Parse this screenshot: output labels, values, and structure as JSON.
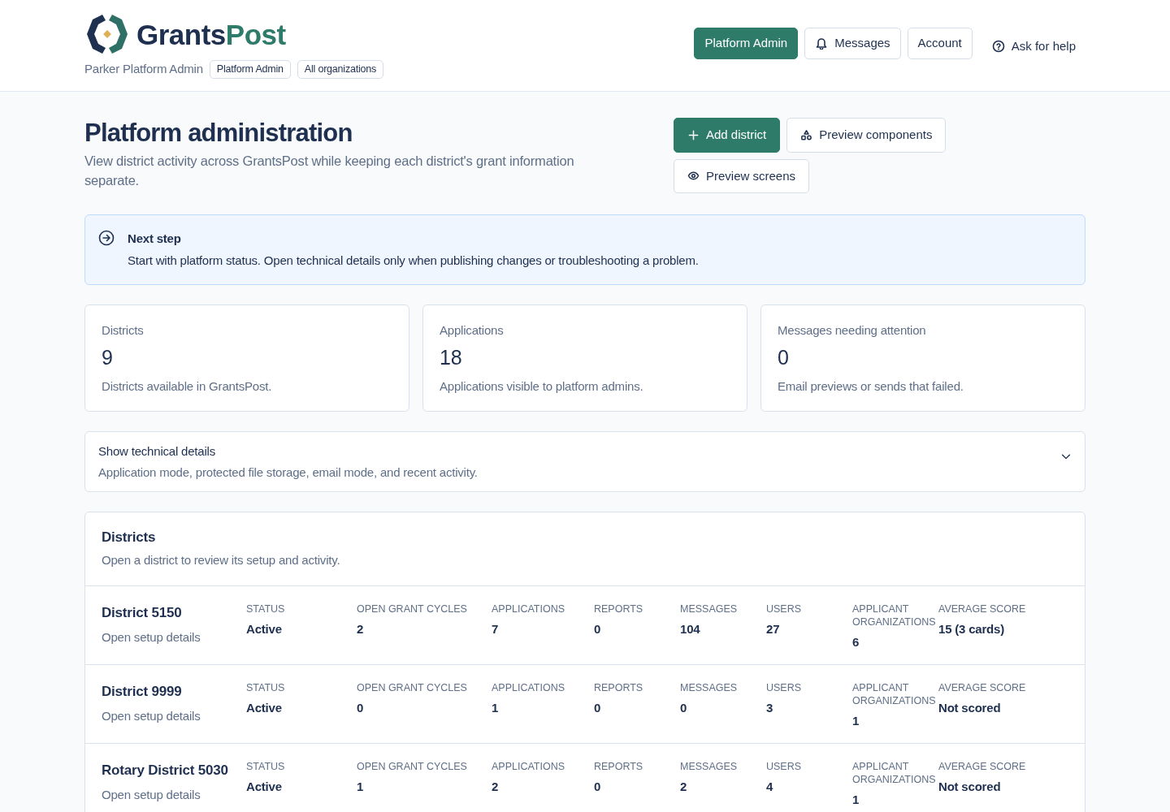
{
  "header": {
    "brand": {
      "first": "Grants",
      "second": "Post"
    },
    "user": "Parker Platform Admin",
    "badges": [
      "Platform Admin",
      "All organizations"
    ],
    "nav": [
      {
        "label": "Platform Admin",
        "kind": "primary",
        "selected": true
      },
      {
        "label": "Messages",
        "kind": "bell",
        "selected": false
      },
      {
        "label": "Account",
        "kind": "plain",
        "selected": false
      }
    ],
    "help": "Ask for help"
  },
  "page": {
    "title": "Platform administration",
    "subtitle": "View district activity across GrantsPost while keeping each district's grant information separate.",
    "actions": [
      {
        "label": "Add district",
        "kind": "add"
      },
      {
        "label": "Preview components",
        "kind": "shapes"
      },
      {
        "label": "Preview screens",
        "kind": "eye"
      }
    ]
  },
  "notice": {
    "title": "Next step",
    "text": "Start with platform status. Open technical details only when publishing changes or troubleshooting a problem."
  },
  "stats": [
    {
      "label": "Districts",
      "value": "9",
      "note": "Districts available in GrantsPost."
    },
    {
      "label": "Applications",
      "value": "18",
      "note": "Applications visible to platform admins."
    },
    {
      "label": "Messages needing attention",
      "value": "0",
      "note": "Email previews or sends that failed."
    }
  ],
  "details": {
    "title": "Show technical details",
    "text": "Application mode, protected file storage, email mode, and recent activity.",
    "expanded": false
  },
  "districts": {
    "title": "Districts",
    "subtitle": "Open a district to review its setup and activity.",
    "rows": [
      {
        "name": "District 5150",
        "link": "Open setup details",
        "cells": [
          {
            "label": "STATUS",
            "value": "Active"
          },
          {
            "label": "OPEN GRANT CYCLES",
            "value": "2"
          },
          {
            "label": "APPLICATIONS",
            "value": "7"
          },
          {
            "label": "REPORTS",
            "value": "0"
          },
          {
            "label": "MESSAGES",
            "value": "104"
          },
          {
            "label": "USERS",
            "value": "27"
          },
          {
            "label": "APPLICANT ORGANIZATIONS",
            "value": "6"
          },
          {
            "label": "AVERAGE SCORE",
            "value": "15 (3 cards)"
          }
        ]
      },
      {
        "name": "District 9999",
        "link": "Open setup details",
        "cells": [
          {
            "label": "STATUS",
            "value": "Active"
          },
          {
            "label": "OPEN GRANT CYCLES",
            "value": "0"
          },
          {
            "label": "APPLICATIONS",
            "value": "1"
          },
          {
            "label": "REPORTS",
            "value": "0"
          },
          {
            "label": "MESSAGES",
            "value": "0"
          },
          {
            "label": "USERS",
            "value": "3"
          },
          {
            "label": "APPLICANT ORGANIZATIONS",
            "value": "1"
          },
          {
            "label": "AVERAGE SCORE",
            "value": "Not scored"
          }
        ]
      },
      {
        "name": "Rotary District 5030",
        "link": "Open setup details",
        "cells": [
          {
            "label": "STATUS",
            "value": "Active"
          },
          {
            "label": "OPEN GRANT CYCLES",
            "value": "1"
          },
          {
            "label": "APPLICATIONS",
            "value": "2"
          },
          {
            "label": "REPORTS",
            "value": "0"
          },
          {
            "label": "MESSAGES",
            "value": "2"
          },
          {
            "label": "USERS",
            "value": "4"
          },
          {
            "label": "APPLICANT ORGANIZATIONS",
            "value": "1"
          },
          {
            "label": "AVERAGE SCORE",
            "value": "Not scored"
          }
        ]
      }
    ]
  }
}
